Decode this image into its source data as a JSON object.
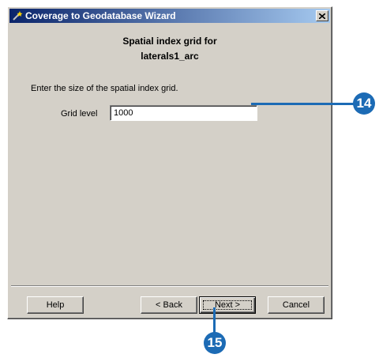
{
  "window": {
    "title": "Coverage to Geodatabase Wizard",
    "close_glyph": "✕"
  },
  "header": {
    "line1": "Spatial index grid for",
    "line2": "laterals1_arc"
  },
  "instruction": "Enter the size of the spatial index grid.",
  "grid_level": {
    "label": "Grid level",
    "value": "1000"
  },
  "buttons": {
    "help": "Help",
    "back": "< Back",
    "next": "Next >",
    "cancel": "Cancel"
  },
  "callouts": {
    "step_a": "14",
    "step_b": "15",
    "color": "#1c6bb5"
  },
  "colors": {
    "dialog_bg": "#d4d0c8",
    "titlebar_start": "#0a246a",
    "titlebar_end": "#a6caf0"
  }
}
